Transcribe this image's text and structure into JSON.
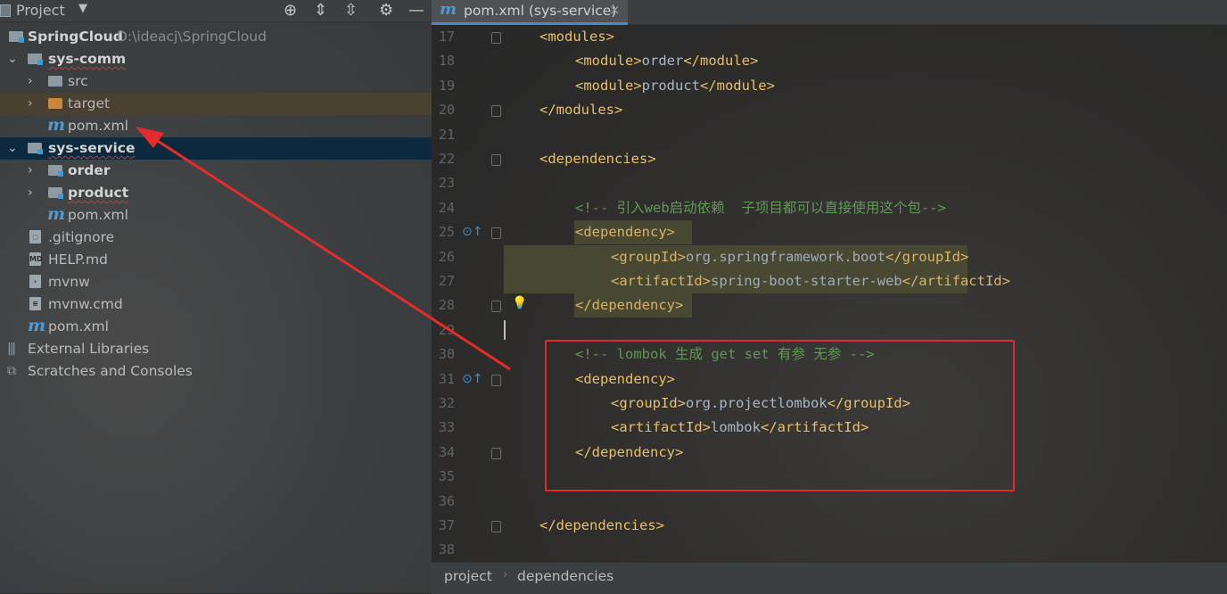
{
  "project_panel": {
    "title": "Project",
    "tree": [
      {
        "label": "SpringCloud",
        "path": "D:\\ideacj\\SpringCloud"
      },
      {
        "label": "sys-comm"
      },
      {
        "label": "src"
      },
      {
        "label": "target"
      },
      {
        "label": "pom.xml"
      },
      {
        "label": "sys-service"
      },
      {
        "label": "order"
      },
      {
        "label": "product"
      },
      {
        "label": "pom.xml"
      },
      {
        "label": ".gitignore"
      },
      {
        "label": "HELP.md"
      },
      {
        "label": "mvnw"
      },
      {
        "label": "mvnw.cmd"
      },
      {
        "label": "pom.xml"
      },
      {
        "label": "External Libraries"
      },
      {
        "label": "Scratches and Consoles"
      }
    ]
  },
  "editor": {
    "tab_label": "pom.xml (sys-service)",
    "tab_icon": "maven-m-icon",
    "lines": [
      {
        "n": "17",
        "indent": 1,
        "parts": [
          [
            "tag",
            "<modules>"
          ]
        ]
      },
      {
        "n": "18",
        "indent": 2,
        "parts": [
          [
            "tag",
            "<module>"
          ],
          [
            "txt",
            "order"
          ],
          [
            "tag",
            "</module>"
          ]
        ]
      },
      {
        "n": "19",
        "indent": 2,
        "parts": [
          [
            "tag",
            "<module>"
          ],
          [
            "txt",
            "product"
          ],
          [
            "tag",
            "</module>"
          ]
        ]
      },
      {
        "n": "20",
        "indent": 1,
        "parts": [
          [
            "tag",
            "</modules>"
          ]
        ]
      },
      {
        "n": "21",
        "indent": 0,
        "parts": []
      },
      {
        "n": "22",
        "indent": 1,
        "parts": [
          [
            "tag",
            "<dependencies>"
          ]
        ]
      },
      {
        "n": "23",
        "indent": 0,
        "parts": []
      },
      {
        "n": "24",
        "indent": 2,
        "parts": [
          [
            "cmt",
            "<!-- 引入web启动依赖  子项目都可以直接使用这个包-->"
          ]
        ]
      },
      {
        "n": "25",
        "indent": 2,
        "parts": [
          [
            "tag",
            "<dependency>"
          ]
        ]
      },
      {
        "n": "26",
        "indent": 3,
        "parts": [
          [
            "tag",
            "<groupId>"
          ],
          [
            "txt",
            "org.springframework.boot"
          ],
          [
            "tag",
            "</groupId>"
          ]
        ]
      },
      {
        "n": "27",
        "indent": 3,
        "parts": [
          [
            "tag",
            "<artifactId>"
          ],
          [
            "txt",
            "spring-boot-starter-web"
          ],
          [
            "tag",
            "</artifactId>"
          ]
        ]
      },
      {
        "n": "28",
        "indent": 2,
        "parts": [
          [
            "tag",
            "</dependency>"
          ]
        ]
      },
      {
        "n": "29",
        "indent": 0,
        "parts": []
      },
      {
        "n": "30",
        "indent": 2,
        "parts": [
          [
            "cmt",
            "<!-- lombok 生成 get set 有参 无参 -->"
          ]
        ]
      },
      {
        "n": "31",
        "indent": 2,
        "parts": [
          [
            "tag",
            "<dependency>"
          ]
        ]
      },
      {
        "n": "32",
        "indent": 3,
        "parts": [
          [
            "tag",
            "<groupId>"
          ],
          [
            "txt",
            "org.projectlombok"
          ],
          [
            "tag",
            "</groupId>"
          ]
        ]
      },
      {
        "n": "33",
        "indent": 3,
        "parts": [
          [
            "tag",
            "<artifactId>"
          ],
          [
            "txt",
            "lombok"
          ],
          [
            "tag",
            "</artifactId>"
          ]
        ]
      },
      {
        "n": "34",
        "indent": 2,
        "parts": [
          [
            "tag",
            "</dependency>"
          ]
        ]
      },
      {
        "n": "35",
        "indent": 0,
        "parts": []
      },
      {
        "n": "36",
        "indent": 0,
        "parts": []
      },
      {
        "n": "37",
        "indent": 1,
        "parts": [
          [
            "tag",
            "</dependencies>"
          ]
        ]
      },
      {
        "n": "38",
        "indent": 0,
        "parts": []
      }
    ],
    "breadcrumb": [
      "project",
      "dependencies"
    ]
  },
  "colors": {
    "tag": "#e8bf6a",
    "text": "#a9b7c6",
    "comment": "#629755",
    "selection": "#0d293e",
    "annotation_red": "#e22a2a"
  }
}
